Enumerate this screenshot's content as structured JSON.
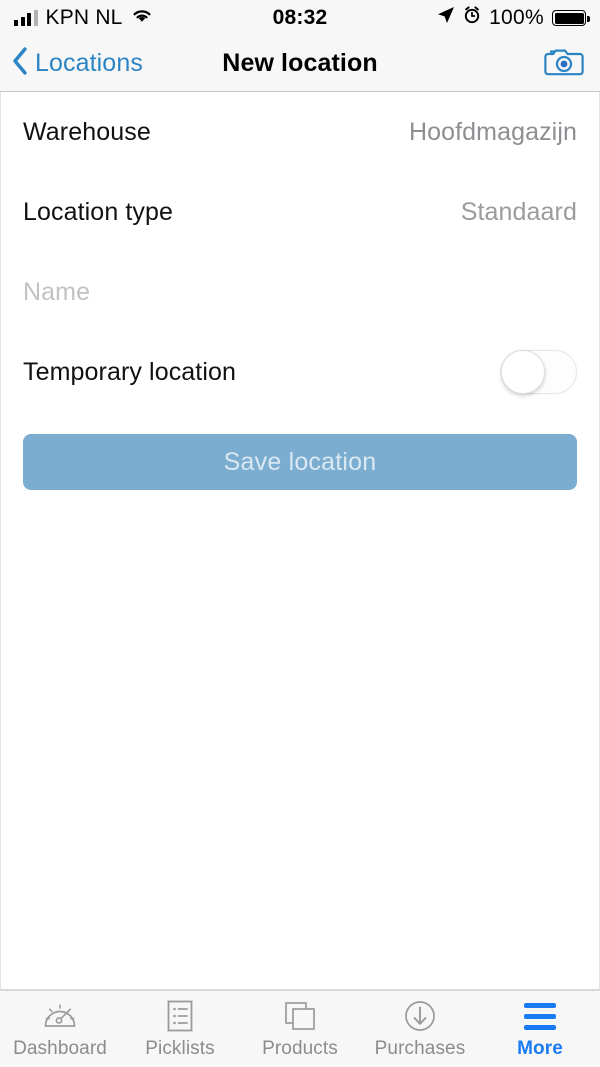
{
  "status_bar": {
    "carrier": "KPN NL",
    "time": "08:32",
    "battery_percent": "100%",
    "icons": [
      "signal-bars-icon",
      "wifi-icon",
      "location-arrow-icon",
      "alarm-clock-icon",
      "battery-icon"
    ]
  },
  "nav": {
    "back_label": "Locations",
    "title": "New location",
    "camera_icon": "camera-icon"
  },
  "form": {
    "warehouse": {
      "label": "Warehouse",
      "value": "Hoofdmagazijn"
    },
    "location_type": {
      "label": "Location type",
      "value": "Standaard"
    },
    "name": {
      "placeholder": "Name",
      "value": ""
    },
    "temporary": {
      "label": "Temporary location",
      "state": "off"
    },
    "save_label": "Save location"
  },
  "colors": {
    "accent_blue": "#1a7cf5",
    "nav_blue": "#2b85c4",
    "save_button": "#7badd0",
    "value_gray": "#8e8e93",
    "placeholder_gray": "#c2c2c6"
  },
  "tabbar": {
    "items": [
      {
        "label": "Dashboard",
        "icon": "gauge-icon",
        "active": false
      },
      {
        "label": "Picklists",
        "icon": "list-document-icon",
        "active": false
      },
      {
        "label": "Products",
        "icon": "stacked-squares-icon",
        "active": false
      },
      {
        "label": "Purchases",
        "icon": "arrow-down-circle-icon",
        "active": false
      },
      {
        "label": "More",
        "icon": "hamburger-icon",
        "active": true
      }
    ]
  }
}
